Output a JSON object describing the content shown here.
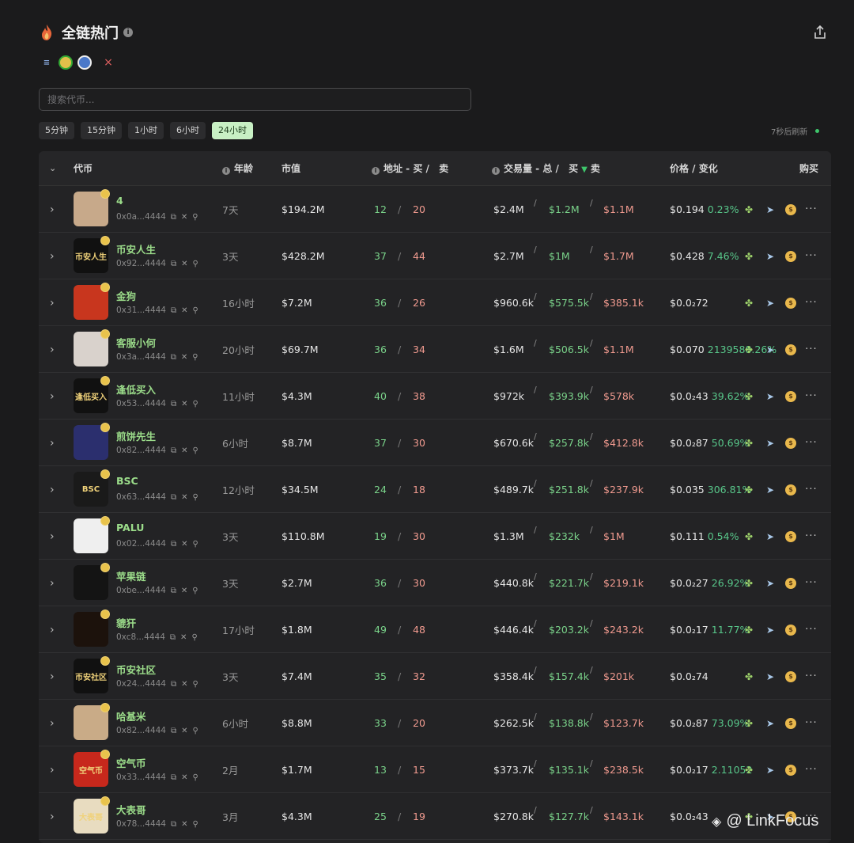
{
  "header": {
    "title": "全链热门",
    "info": "i"
  },
  "chains": {
    "close": "×"
  },
  "search": {
    "placeholder": "搜索代币..."
  },
  "timeframes": [
    "5分钟",
    "15分钟",
    "1小时",
    "6小时",
    "24小时"
  ],
  "active_timeframe": "24小时",
  "refresh_text": "7秒后刷新",
  "columns": {
    "token": "代币",
    "age": "年龄",
    "mcap": "市值",
    "addr_label": "地址 - 买 /",
    "addr_sell": "卖",
    "vol_label": "交易量 - 总 /",
    "vol_buy": "买",
    "vol_sell": "卖",
    "price": "价格 / 变化",
    "buy": "购买"
  },
  "rows": [
    {
      "name": "4",
      "addr": "0x0a...4444",
      "age": "7天",
      "mcap": "$194.2M",
      "buys": "12",
      "sells": "20",
      "vol": "$2.4M",
      "vbuy": "$1.2M",
      "vsell": "$1.1M",
      "price": "$0.194",
      "chg": "0.23%",
      "avatar_text": "",
      "avatar_bg": "#c7a98a"
    },
    {
      "name": "币安人生",
      "addr": "0x92...4444",
      "age": "3天",
      "mcap": "$428.2M",
      "buys": "37",
      "sells": "44",
      "vol": "$2.7M",
      "vbuy": "$1M",
      "vsell": "$1.7M",
      "price": "$0.428",
      "chg": "7.46%",
      "avatar_text": "币安人生",
      "avatar_bg": "#111111"
    },
    {
      "name": "金狗",
      "addr": "0x31...4444",
      "age": "16小时",
      "mcap": "$7.2M",
      "buys": "36",
      "sells": "26",
      "vol": "$960.6k",
      "vbuy": "$575.5k",
      "vsell": "$385.1k",
      "price": "$0.0₂72",
      "chg": "",
      "avatar_text": "",
      "avatar_bg": "#c8361e"
    },
    {
      "name": "客服小何",
      "addr": "0x3a...4444",
      "age": "20小时",
      "mcap": "$69.7M",
      "buys": "36",
      "sells": "34",
      "vol": "$1.6M",
      "vbuy": "$506.5k",
      "vsell": "$1.1M",
      "price": "$0.070",
      "chg": "2139588.26%",
      "avatar_text": "",
      "avatar_bg": "#d9d2cc"
    },
    {
      "name": "逢低买入",
      "addr": "0x53...4444",
      "age": "11小时",
      "mcap": "$4.3M",
      "buys": "40",
      "sells": "38",
      "vol": "$972k",
      "vbuy": "$393.9k",
      "vsell": "$578k",
      "price": "$0.0₂43",
      "chg": "39.62%",
      "avatar_text": "逢低买入",
      "avatar_bg": "#111111"
    },
    {
      "name": "煎饼先生",
      "addr": "0x82...4444",
      "age": "6小时",
      "mcap": "$8.7M",
      "buys": "37",
      "sells": "30",
      "vol": "$670.6k",
      "vbuy": "$257.8k",
      "vsell": "$412.8k",
      "price": "$0.0₂87",
      "chg": "50.69%",
      "avatar_text": "",
      "avatar_bg": "#2b2f6e"
    },
    {
      "name": "BSC",
      "addr": "0x63...4444",
      "age": "12小时",
      "mcap": "$34.5M",
      "buys": "24",
      "sells": "18",
      "vol": "$489.7k",
      "vbuy": "$251.8k",
      "vsell": "$237.9k",
      "price": "$0.035",
      "chg": "306.81%",
      "avatar_text": "BSC",
      "avatar_bg": "#1a1a1a"
    },
    {
      "name": "PALU",
      "addr": "0x02...4444",
      "age": "3天",
      "mcap": "$110.8M",
      "buys": "19",
      "sells": "30",
      "vol": "$1.3M",
      "vbuy": "$232k",
      "vsell": "$1M",
      "price": "$0.111",
      "chg": "0.54%",
      "avatar_text": "",
      "avatar_bg": "#efefef"
    },
    {
      "name": "苹果链",
      "addr": "0xbe...4444",
      "age": "3天",
      "mcap": "$2.7M",
      "buys": "36",
      "sells": "30",
      "vol": "$440.8k",
      "vbuy": "$221.7k",
      "vsell": "$219.1k",
      "price": "$0.0₂27",
      "chg": "26.92%",
      "avatar_text": "",
      "avatar_bg": "#141414"
    },
    {
      "name": "貔犴",
      "addr": "0xc8...4444",
      "age": "17小时",
      "mcap": "$1.8M",
      "buys": "49",
      "sells": "48",
      "vol": "$446.4k",
      "vbuy": "$203.2k",
      "vsell": "$243.2k",
      "price": "$0.0₂17",
      "chg": "11.77%",
      "avatar_text": "",
      "avatar_bg": "#1c120c"
    },
    {
      "name": "币安社区",
      "addr": "0x24...4444",
      "age": "3天",
      "mcap": "$7.4M",
      "buys": "35",
      "sells": "32",
      "vol": "$358.4k",
      "vbuy": "$157.4k",
      "vsell": "$201k",
      "price": "$0.0₂74",
      "chg": "",
      "avatar_text": "币安社区",
      "avatar_bg": "#111111"
    },
    {
      "name": "哈基米",
      "addr": "0x82...4444",
      "age": "6小时",
      "mcap": "$8.8M",
      "buys": "33",
      "sells": "20",
      "vol": "$262.5k",
      "vbuy": "$138.8k",
      "vsell": "$123.7k",
      "price": "$0.0₂87",
      "chg": "73.09%",
      "avatar_text": "",
      "avatar_bg": "#c9ab87"
    },
    {
      "name": "空气币",
      "addr": "0x33...4444",
      "age": "2月",
      "mcap": "$1.7M",
      "buys": "13",
      "sells": "15",
      "vol": "$373.7k",
      "vbuy": "$135.1k",
      "vsell": "$238.5k",
      "price": "$0.0₂17",
      "chg": "2.11052",
      "avatar_text": "空气币",
      "avatar_bg": "#c7281c"
    },
    {
      "name": "大表哥",
      "addr": "0x78...4444",
      "age": "3月",
      "mcap": "$4.3M",
      "buys": "25",
      "sells": "19",
      "vol": "$270.8k",
      "vbuy": "$127.7k",
      "vsell": "$143.1k",
      "price": "$0.0₂43",
      "chg": "",
      "avatar_text": "大表哥",
      "avatar_bg": "#e8dcc0"
    }
  ],
  "watermark": "@ LinkFocus",
  "colors": {
    "accent_green": "#7ad38a",
    "sell_red": "#f09a8f",
    "active_tab": "#c8f0c4",
    "background": "#1b1b1c"
  }
}
